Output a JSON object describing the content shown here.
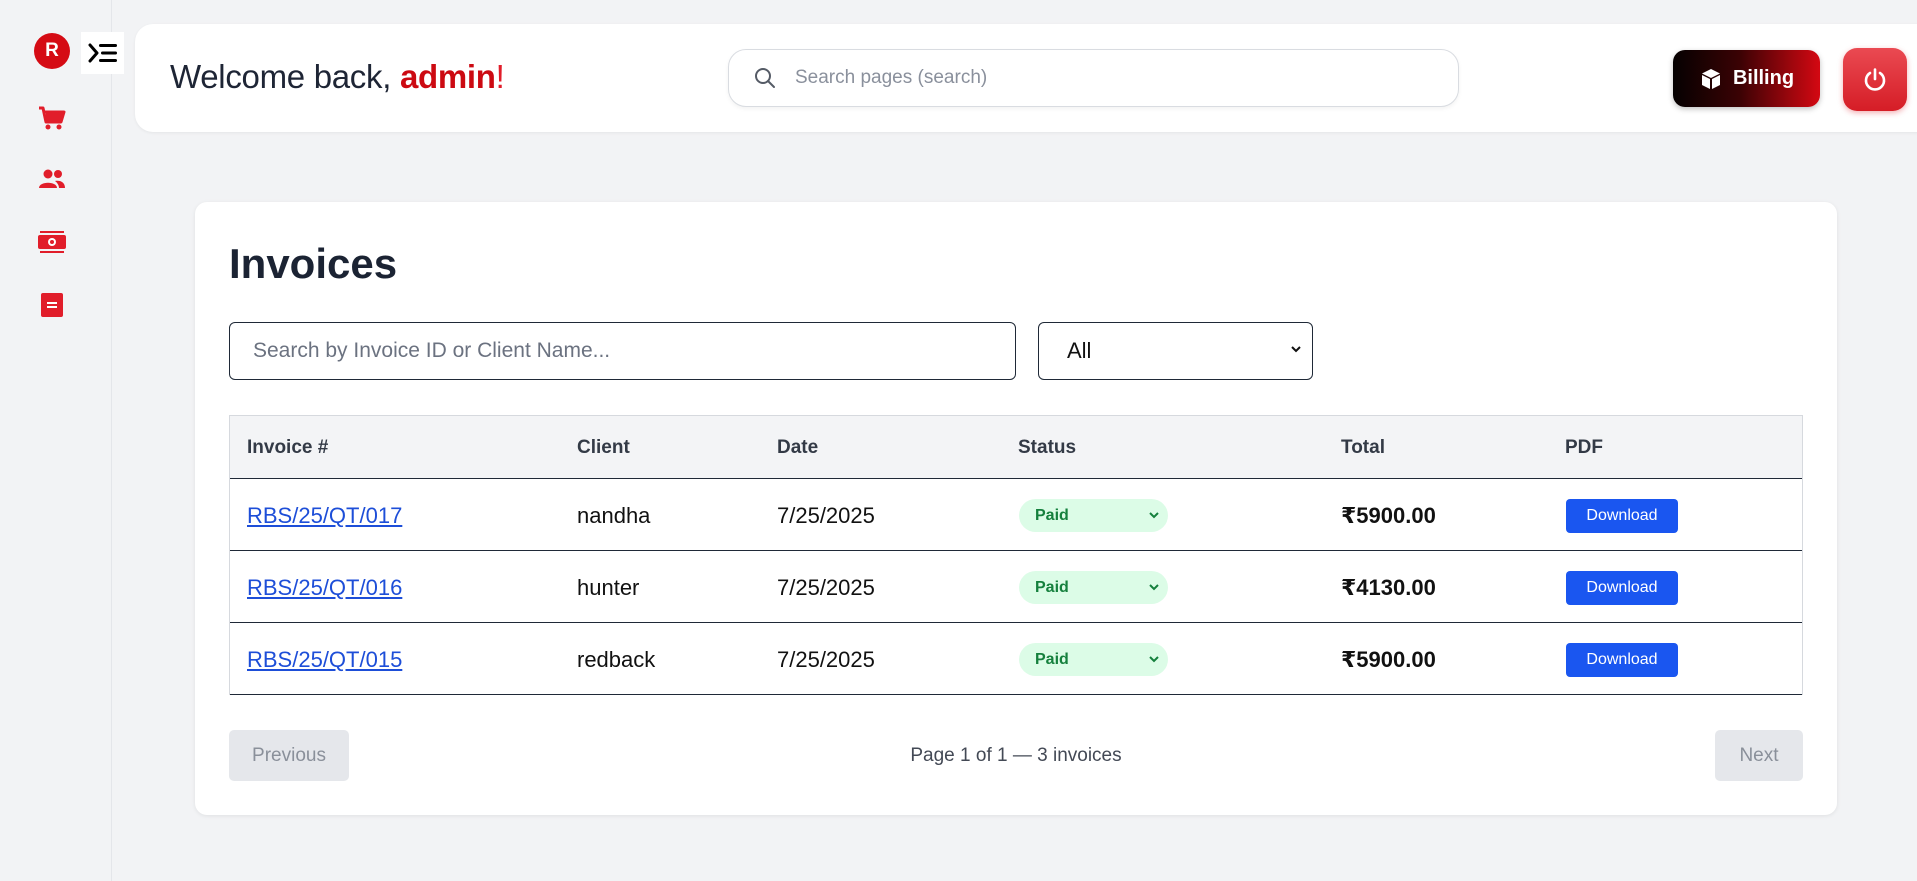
{
  "brand": {
    "logo_letter": "R",
    "accent": "#cc0a12"
  },
  "sidebar": {
    "items": [
      {
        "icon": "cart-icon",
        "name": "sidebar-item-orders"
      },
      {
        "icon": "users-icon",
        "name": "sidebar-item-clients"
      },
      {
        "icon": "money-icon",
        "name": "sidebar-item-payments"
      },
      {
        "icon": "document-icon",
        "name": "sidebar-item-invoices"
      }
    ]
  },
  "header": {
    "welcome_prefix": "Welcome back, ",
    "username": "admin",
    "welcome_suffix": "!",
    "search_placeholder": "Search pages (search)",
    "billing_label": "Billing"
  },
  "main": {
    "title": "Invoices",
    "search_placeholder": "Search by Invoice ID or Client Name...",
    "filter_value": "All",
    "columns": [
      "Invoice #",
      "Client",
      "Date",
      "Status",
      "Total",
      "PDF"
    ],
    "rows": [
      {
        "invoice": "RBS/25/QT/017",
        "client": "nandha",
        "date": "7/25/2025",
        "status": "Paid",
        "total": "₹5900.00",
        "pdf": "Download"
      },
      {
        "invoice": "RBS/25/QT/016",
        "client": "hunter",
        "date": "7/25/2025",
        "status": "Paid",
        "total": "₹4130.00",
        "pdf": "Download"
      },
      {
        "invoice": "RBS/25/QT/015",
        "client": "redback",
        "date": "7/25/2025",
        "status": "Paid",
        "total": "₹5900.00",
        "pdf": "Download"
      }
    ],
    "pagination": {
      "previous_label": "Previous",
      "next_label": "Next",
      "info": "Page 1 of 1 — 3 invoices"
    }
  }
}
